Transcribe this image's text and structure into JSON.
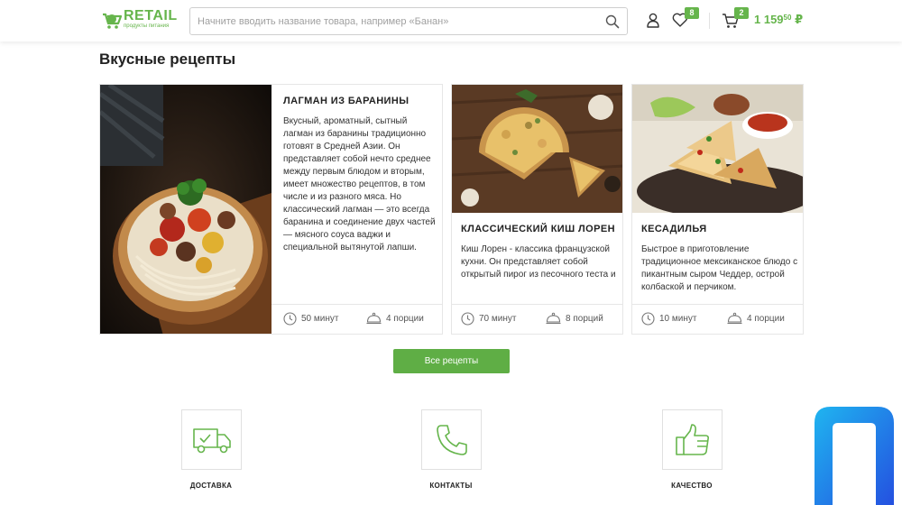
{
  "header": {
    "logo_main": "RETAIL",
    "logo_sub": "продукты питания",
    "search_placeholder": "Начните вводить название товара, например «Банан»",
    "favorites_count": "8",
    "cart_count": "2",
    "price_main": "1 159",
    "price_cents": "50",
    "currency": "₽"
  },
  "section": {
    "title": "Вкусные рецепты",
    "all_button": "Все рецепты"
  },
  "recipes": [
    {
      "title": "Лагман из баранины",
      "description": "Вкусный, ароматный, сытный лагман из баранины традиционно готовят в Средней Азии. Он представляет собой нечто среднее между первым блюдом и вторым, имеет множество рецептов, в том числе и из разного мяса. Но классический лагман — это всегда баранина и соединение двух частей — мясного соуса ваджи и специальной вытянутой лапши.",
      "time": "50 минут",
      "portions": "4 порции"
    },
    {
      "title": "Классический киш Лорен",
      "description": "Киш Лорен - классика французской кухни. Он представляет собой открытый пирог из песочного теста и",
      "time": "70 минут",
      "portions": "8 порций"
    },
    {
      "title": "Кесадилья",
      "description": "Быстрое в приготовление традиционное мексиканское блюдо с пикантным сыром Чеддер, острой колбаской и перчиком.",
      "time": "10 минут",
      "portions": "4 порции"
    }
  ],
  "features": [
    {
      "label": "Доставка",
      "icon": "delivery-truck-icon"
    },
    {
      "label": "Контакты",
      "icon": "phone-icon"
    },
    {
      "label": "Качество",
      "icon": "thumbs-up-icon"
    }
  ],
  "colors": {
    "accent": "#66b54c",
    "button": "#5fae45",
    "corner_logo": "#2f7cf0"
  }
}
